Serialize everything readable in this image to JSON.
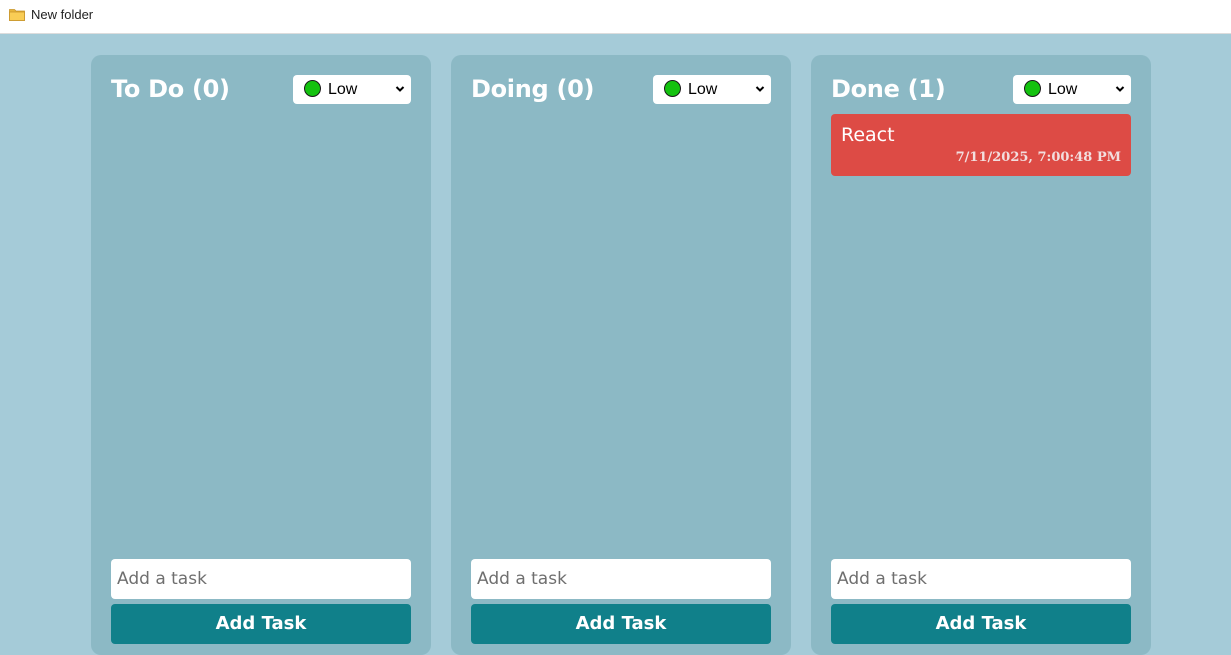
{
  "window": {
    "title": "New folder",
    "icon": "folder-icon"
  },
  "colors": {
    "background": "#a5cbd8",
    "column": "#8cb9c5",
    "button": "#10808a",
    "task_card": "#dd4b45",
    "priority_low": "#14c20f"
  },
  "columns": [
    {
      "title": "To Do (0)",
      "priority": "Low",
      "input_placeholder": "Add a task",
      "input_value": "",
      "button_label": "Add Task",
      "tasks": []
    },
    {
      "title": "Doing (0)",
      "priority": "Low",
      "input_placeholder": "Add a task",
      "input_value": "",
      "button_label": "Add Task",
      "tasks": []
    },
    {
      "title": "Done (1)",
      "priority": "Low",
      "input_placeholder": "Add a task",
      "input_value": "",
      "button_label": "Add Task",
      "tasks": [
        {
          "title": "React",
          "timestamp": "7/11/2025, 7:00:48 PM"
        }
      ]
    }
  ]
}
